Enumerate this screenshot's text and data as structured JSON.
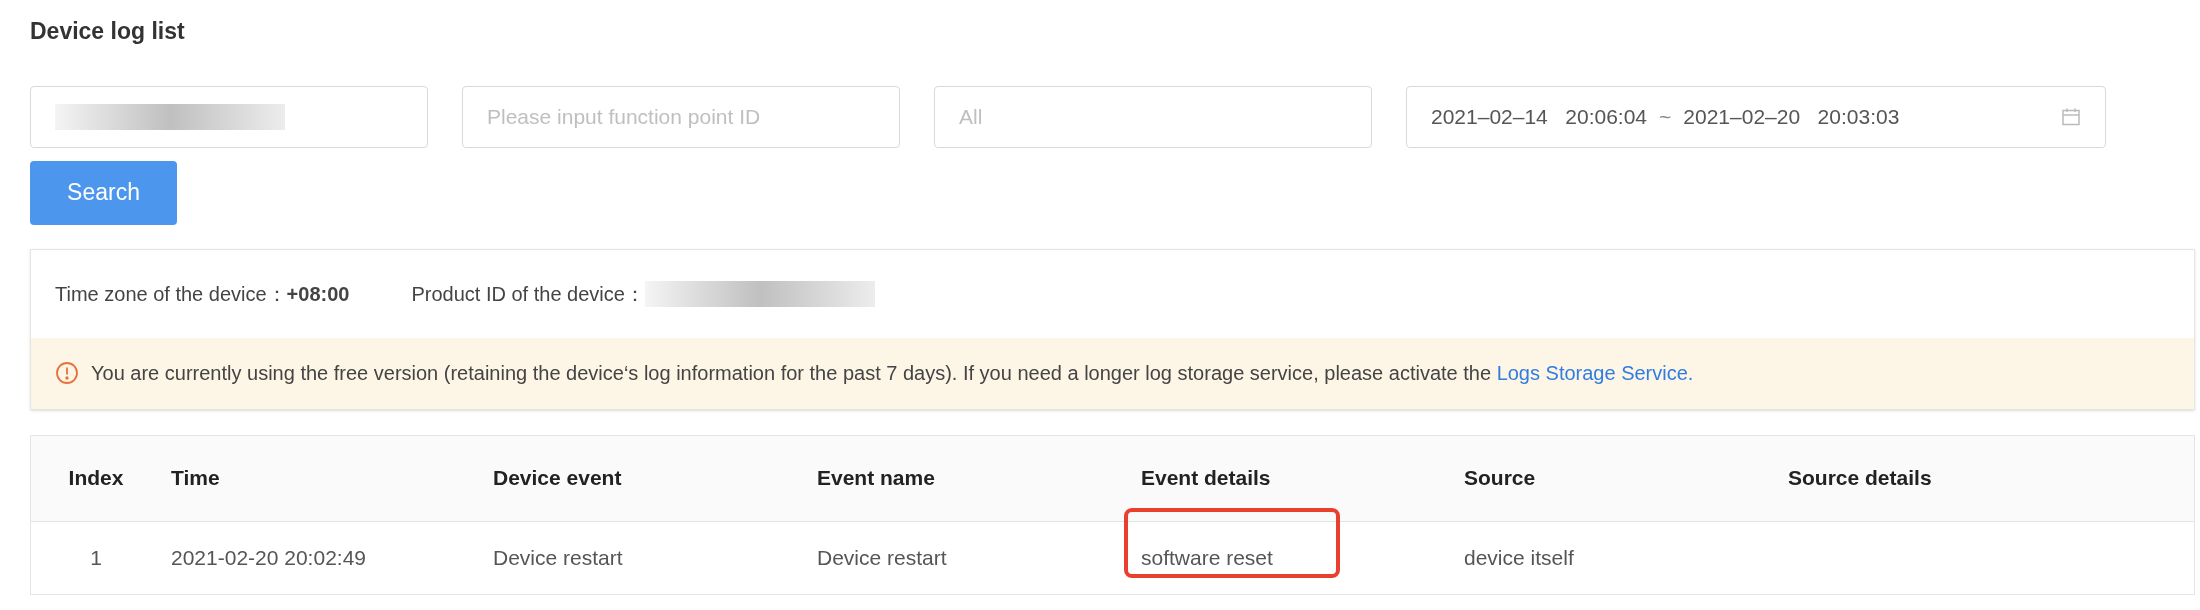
{
  "title": "Device log list",
  "filters": [
    {
      "kind": "text",
      "redacted": true
    },
    {
      "kind": "text",
      "placeholder": "Please input function point ID"
    },
    {
      "kind": "select",
      "placeholder": "All"
    },
    {
      "kind": "daterange",
      "start": "2021–02–14   20:06:04",
      "separator": "~",
      "end": "2021–02–20   20:03:03"
    }
  ],
  "search_button": "Search",
  "info": {
    "items": [
      {
        "label": "Time zone of the device：",
        "value": "+08:00"
      },
      {
        "label": "Product ID of the device：",
        "redacted": true
      }
    ],
    "notice": "You are currently using the free version (retaining the device‘s log information for the past 7 days). If you need a longer log storage service, please activate the",
    "notice_link": "Logs Storage Service."
  },
  "table": {
    "columns": [
      "Index",
      "Time",
      "Device event",
      "Event name",
      "Event details",
      "Source",
      "Source details"
    ],
    "rows": [
      {
        "cells": [
          {
            "text": "1",
            "highlighted": false
          },
          {
            "text": "2021-02-20 20:02:49",
            "highlighted": false
          },
          {
            "text": "Device restart",
            "highlighted": false
          },
          {
            "text": "Device restart",
            "highlighted": false
          },
          {
            "text": "software reset",
            "highlighted": true
          },
          {
            "text": "device itself",
            "highlighted": false
          }
        ]
      }
    ]
  }
}
